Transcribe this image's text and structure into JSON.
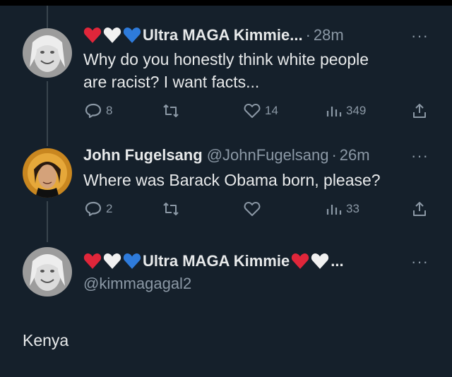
{
  "tweets": [
    {
      "emoji_prefix": [
        "red-heart",
        "white-heart",
        "blue-heart"
      ],
      "display_name": "Ultra MAGA Kimmie...",
      "timestamp": "28m",
      "text_line1": "Why do you honestly think white people",
      "text_line2": "are racist? I want facts...",
      "actions": {
        "replies": "8",
        "retweets": "",
        "likes": "14",
        "views": "349"
      }
    },
    {
      "display_name": "John Fugelsang",
      "handle": "@JohnFugelsang",
      "timestamp": "26m",
      "text": "Where was Barack Obama born, please?",
      "actions": {
        "replies": "2",
        "retweets": "",
        "likes": "",
        "views": "33"
      }
    },
    {
      "emoji_prefix": [
        "red-heart",
        "white-heart",
        "blue-heart"
      ],
      "display_name": "Ultra MAGA Kimmie",
      "emoji_suffix": [
        "red-heart",
        "white-heart"
      ],
      "name_trunc": "...",
      "handle": "@kimmagagal2",
      "text": "Kenya"
    }
  ],
  "more_label": "···",
  "dot_sep": "·",
  "colors": {
    "background": "#15202b",
    "muted": "#8b98a5",
    "text": "#e7e9ea",
    "thread_line": "#38444d"
  }
}
